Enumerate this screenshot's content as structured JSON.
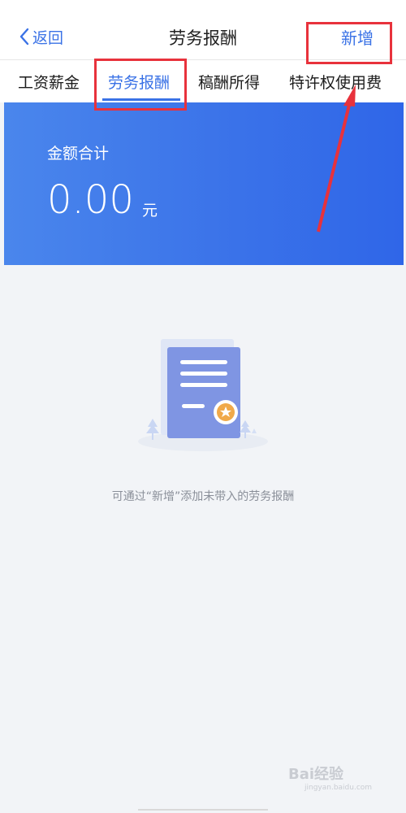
{
  "nav": {
    "back_label": "返回",
    "title": "劳务报酬",
    "add_label": "新增"
  },
  "tabs": [
    {
      "label": "工资薪金",
      "active": false
    },
    {
      "label": "劳务报酬",
      "active": true
    },
    {
      "label": "稿酬所得",
      "active": false
    },
    {
      "label": "特许权使用费",
      "active": false
    }
  ],
  "summary": {
    "label": "金额合计",
    "amount": "0.00",
    "unit": "元"
  },
  "empty_state": {
    "icon": "document-certificate-illustration",
    "message": "可通过“新增”添加未带入的劳务报酬"
  },
  "watermark": {
    "brand": "Bai经验",
    "url": "jingyan.baidu.com"
  },
  "colors": {
    "accent": "#3a72e6",
    "banner": "#3b73e9",
    "highlight": "#e8323c",
    "background": "#f2f4f7"
  }
}
